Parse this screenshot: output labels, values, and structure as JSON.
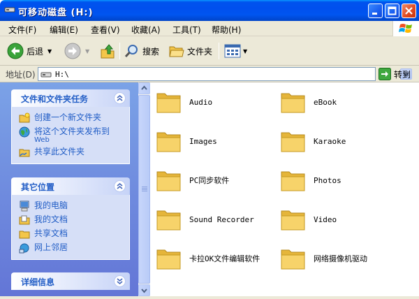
{
  "window": {
    "title": "可移动磁盘 (H:)"
  },
  "menu": [
    "文件(F)",
    "编辑(E)",
    "查看(V)",
    "收藏(A)",
    "工具(T)",
    "帮助(H)"
  ],
  "toolbar": {
    "back": "后退",
    "search": "搜索",
    "folders": "文件夹"
  },
  "address": {
    "label": "地址(D)",
    "value": "H:\\",
    "go": "转到"
  },
  "tasks_panel": {
    "title": "文件和文件夹任务",
    "items": [
      {
        "label": "创建一个新文件夹"
      },
      {
        "label": "将这个文件夹发布到",
        "sub": "Web"
      },
      {
        "label": "共享此文件夹"
      }
    ]
  },
  "places_panel": {
    "title": "其它位置",
    "items": [
      {
        "label": "我的电脑"
      },
      {
        "label": "我的文档"
      },
      {
        "label": "共享文档"
      },
      {
        "label": "网上邻居"
      }
    ]
  },
  "details_panel": {
    "title": "详细信息"
  },
  "folders": [
    "Audio",
    "eBook",
    "Images",
    "Karaoke",
    "PC同步软件",
    "Photos",
    "Sound Recorder",
    "Video",
    "卡拉OK文件编辑软件",
    "网络摄像机驱动"
  ],
  "colors": {
    "title_blue": "#0054e3",
    "pane_blue": "#6e8fdc",
    "link_blue": "#215dc6",
    "folder_yellow": "#f6d56b"
  }
}
